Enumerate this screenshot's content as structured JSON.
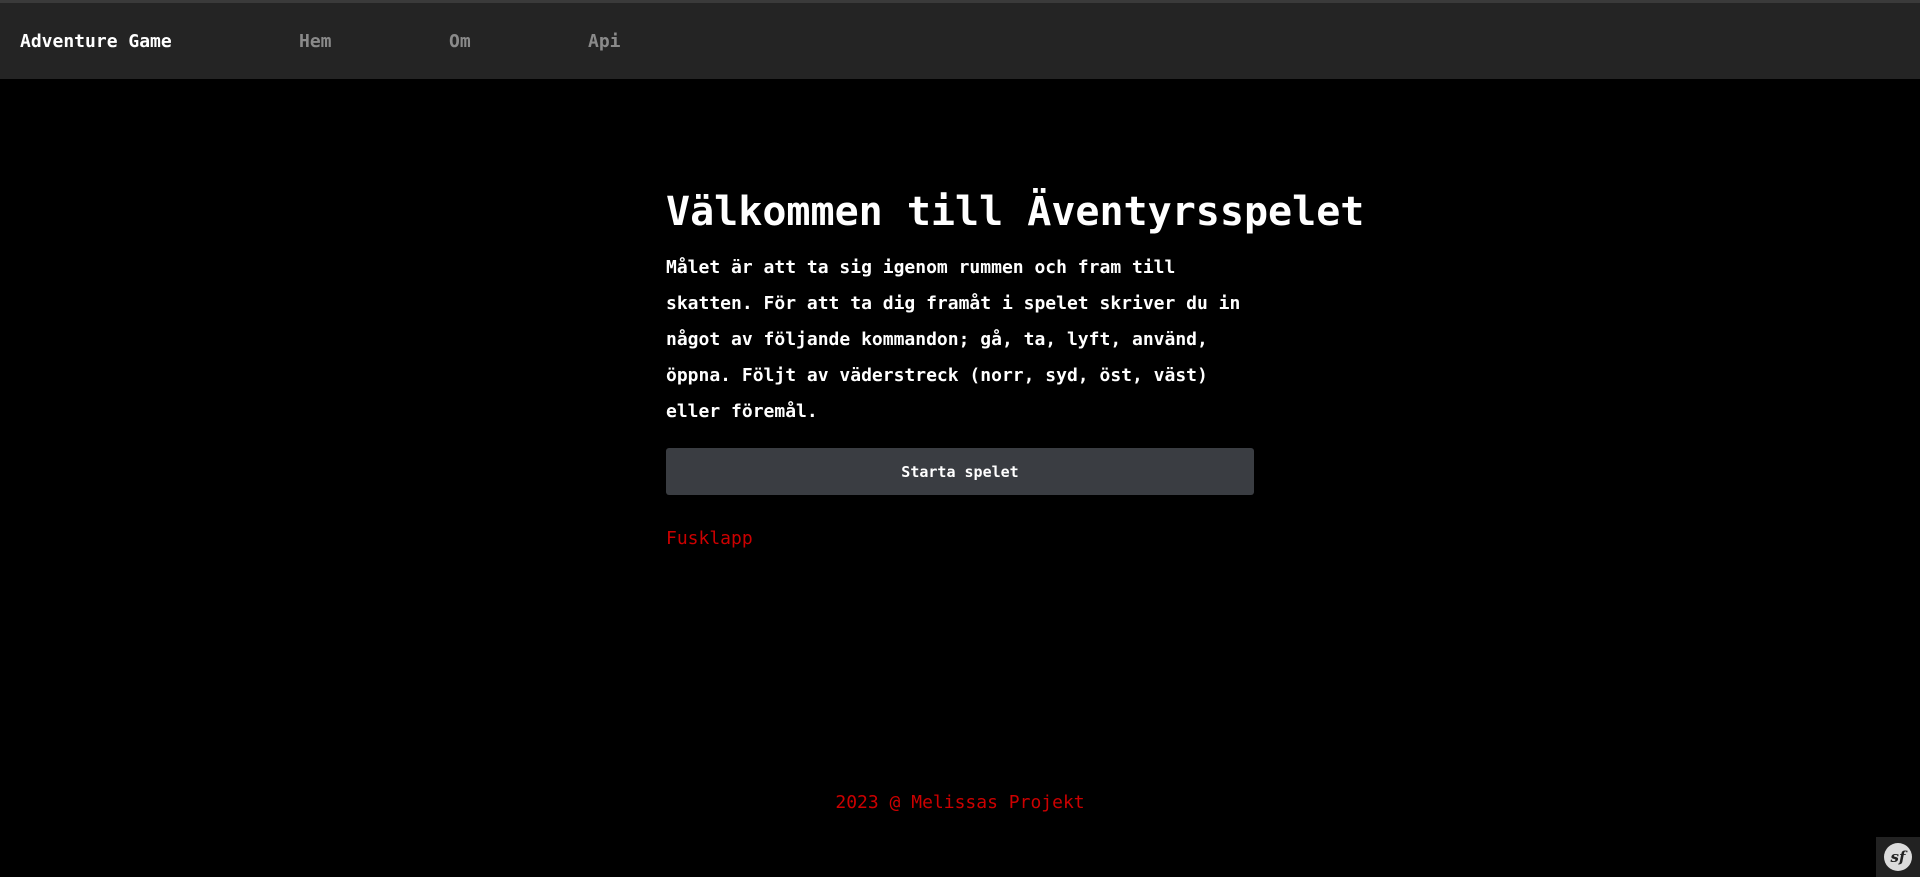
{
  "navbar": {
    "brand": "Adventure Game",
    "links": [
      {
        "label": "Hem"
      },
      {
        "label": "Om"
      },
      {
        "label": "Api"
      }
    ]
  },
  "main": {
    "title": "Välkommen till Äventyrsspelet",
    "intro": "Målet är att ta sig igenom rummen och fram till skatten. För att ta dig framåt i spelet skriver du in något av följande kommandon; gå, ta, lyft, använd, öppna. Följt av väderstreck (norr, syd, öst, väst) eller föremål.",
    "start_button": "Starta spelet",
    "cheat_link": "Fusklapp"
  },
  "footer": {
    "text": "2023 @ Melissas Projekt"
  },
  "debug_toolbar": {
    "logo_text": "sf"
  },
  "colors": {
    "background": "#000000",
    "navbar": "#242424",
    "nav_link": "#8a8a8a",
    "button": "#3a3d42",
    "accent_red": "#cc0000"
  },
  "icons": {
    "debug_toolbar": "symfony-logo-icon"
  }
}
